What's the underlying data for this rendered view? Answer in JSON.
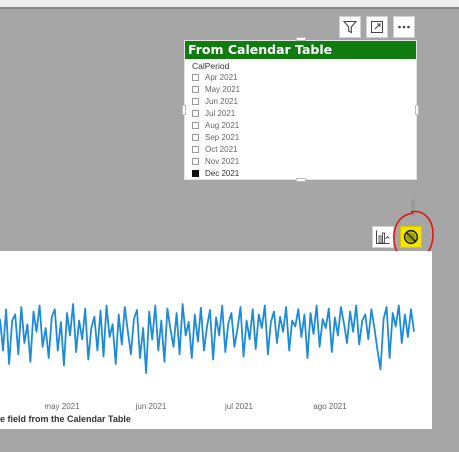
{
  "slicer": {
    "title": "From Calendar Table",
    "field": "CalPeriod",
    "items": [
      {
        "label": "Apr 2021",
        "checked": false
      },
      {
        "label": "May 2021",
        "checked": false
      },
      {
        "label": "Jun 2021",
        "checked": false
      },
      {
        "label": "Jul 2021",
        "checked": false
      },
      {
        "label": "Aug 2021",
        "checked": false
      },
      {
        "label": "Sep 2021",
        "checked": false
      },
      {
        "label": "Oct 2021",
        "checked": false
      },
      {
        "label": "Nov 2021",
        "checked": false
      },
      {
        "label": "Dec 2021",
        "checked": true
      }
    ],
    "title_bg": "#107c10"
  },
  "slicer_header_icons": [
    "filter-icon",
    "focus-mode-icon",
    "more-options-icon"
  ],
  "chart_header_icons": [
    "analytics-icon",
    "not-available-icon"
  ],
  "chart": {
    "footer_text": "e field from the Calendar Table",
    "line_color": "#1e8bd8"
  },
  "chart_data": {
    "type": "line",
    "x_tick_labels": [
      "may 2021",
      "jun 2021",
      "jul 2021",
      "ago 2021"
    ],
    "values": [
      0.72,
      0.3,
      0.85,
      0.12,
      0.7,
      0.78,
      0.25,
      0.88,
      0.4,
      0.65,
      0.15,
      0.82,
      0.55,
      0.9,
      0.35,
      0.6,
      0.2,
      0.75,
      0.85,
      0.3,
      0.68,
      0.1,
      0.8,
      0.5,
      0.92,
      0.28,
      0.7,
      0.45,
      0.86,
      0.18,
      0.6,
      0.75,
      0.3,
      0.83,
      0.22,
      0.9,
      0.48,
      0.65,
      0.12,
      0.78,
      0.38,
      0.88,
      0.55,
      0.25,
      0.72,
      0.84,
      0.2,
      0.6,
      0.0,
      0.82,
      0.45,
      0.9,
      0.3,
      0.7,
      0.15,
      0.86,
      0.58,
      0.35,
      0.8,
      0.25,
      0.92,
      0.5,
      0.68,
      0.2,
      0.78,
      0.42,
      0.87,
      0.3,
      0.62,
      0.84,
      0.18,
      0.74,
      0.5,
      0.9,
      0.28,
      0.66,
      0.8,
      0.35,
      0.58,
      0.88,
      0.22,
      0.7,
      0.45,
      0.85,
      0.32,
      0.78,
      0.6,
      0.9,
      0.25,
      0.68,
      0.82,
      0.4,
      0.75,
      0.55,
      0.88,
      0.3,
      0.7,
      0.62,
      0.85,
      0.48,
      0.78,
      0.2,
      0.8,
      0.52,
      0.9,
      0.35,
      0.72,
      0.6,
      0.86,
      0.28,
      0.74,
      0.5,
      0.88,
      0.66,
      0.4,
      0.82,
      0.55,
      0.9,
      0.38,
      0.7,
      0.78,
      0.45,
      0.85,
      0.6,
      0.3,
      0.05,
      0.72,
      0.88,
      0.2,
      0.8,
      0.62,
      0.9,
      0.4,
      0.78,
      0.48,
      0.85,
      0.55
    ],
    "grid": false,
    "legend": "none"
  }
}
